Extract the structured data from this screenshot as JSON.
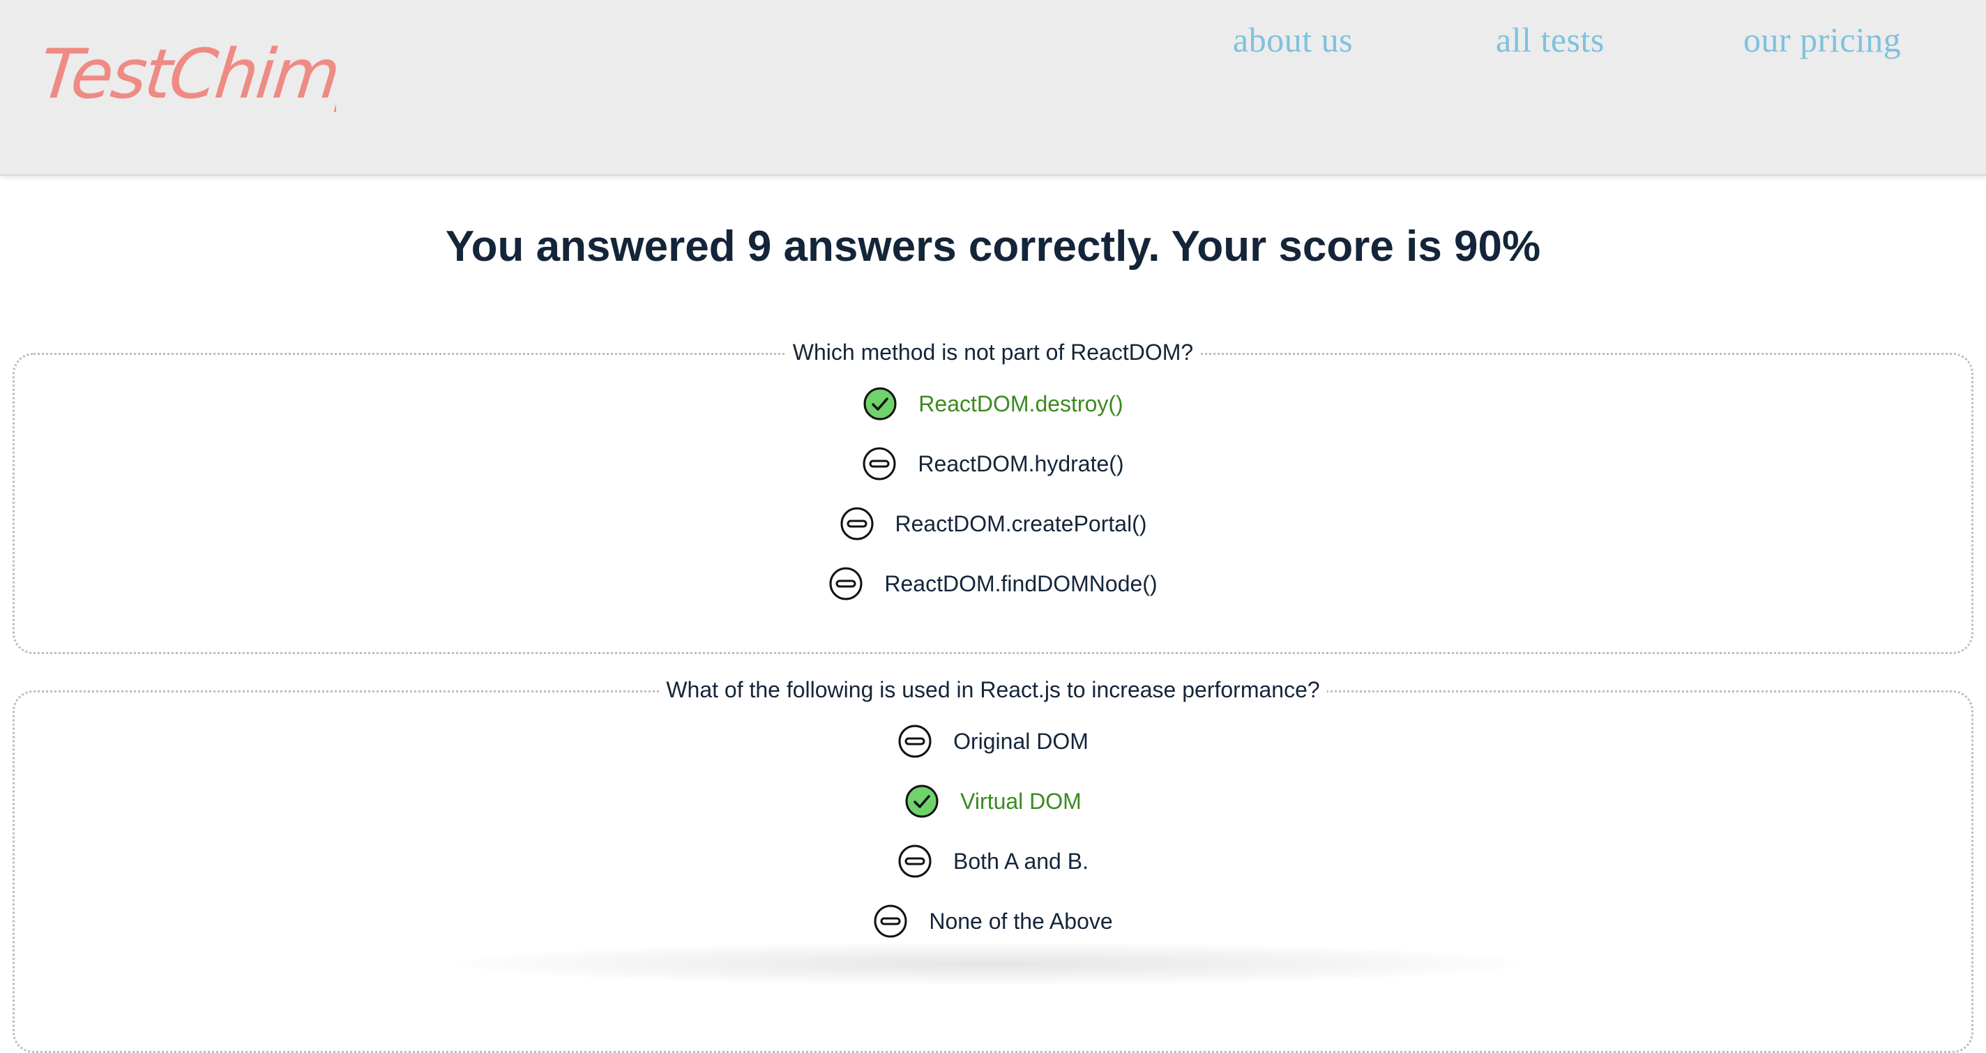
{
  "header": {
    "logo_text": "TestChimp",
    "nav": {
      "about": "about us",
      "tests": "all tests",
      "pricing": "our pricing"
    }
  },
  "result": {
    "title": "You answered 9 answers correctly. Your score is 90%"
  },
  "questions": [
    {
      "text": "Which method is not part of ReactDOM?",
      "options": [
        {
          "label": "ReactDOM.destroy()",
          "state": "correct",
          "icon": "check-circle-icon"
        },
        {
          "label": "ReactDOM.hydrate()",
          "state": "neutral",
          "icon": "minus-circle-icon"
        },
        {
          "label": "ReactDOM.createPortal()",
          "state": "neutral",
          "icon": "minus-circle-icon"
        },
        {
          "label": "ReactDOM.findDOMNode()",
          "state": "neutral",
          "icon": "minus-circle-icon"
        }
      ]
    },
    {
      "text": "What of the following is used in React.js to increase performance?",
      "options": [
        {
          "label": "Original DOM",
          "state": "neutral",
          "icon": "minus-circle-icon"
        },
        {
          "label": "Virtual DOM",
          "state": "correct",
          "icon": "check-circle-icon"
        },
        {
          "label": "Both A and B.",
          "state": "neutral",
          "icon": "minus-circle-icon"
        },
        {
          "label": "None of the Above",
          "state": "neutral",
          "icon": "minus-circle-icon"
        }
      ]
    }
  ],
  "colors": {
    "logo": "#ef8a84",
    "nav_link": "#7fc1df",
    "header_bg": "#ececec",
    "title_text": "#14253a",
    "correct_text": "#3a8a1e",
    "correct_icon_fill": "#6fd26a",
    "card_border": "#bdbdbd"
  }
}
